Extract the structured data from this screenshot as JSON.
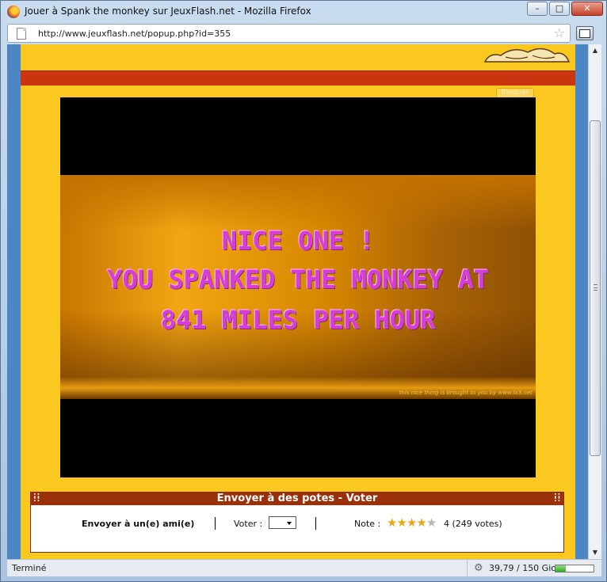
{
  "window": {
    "title": "Jouer à Spank the monkey sur JeuxFlash.net - Mozilla Firefox",
    "minimize": "–",
    "maximize": "□",
    "close": "✕"
  },
  "urlbar": {
    "url": "http://www.jeuxflash.net/popup.php?id=355",
    "star": "☆"
  },
  "page": {
    "bloquer": "Bloquer",
    "game": {
      "line1": "NICE ONE !",
      "line2": "YOU SPANKED THE MONKEY AT",
      "line3": "841 MILES PER HOUR",
      "credit": "this nice thing is brought to you by www.bi3.net"
    },
    "panel": {
      "title": "Envoyer à des potes - Voter",
      "send_friend": "Envoyer à un(e) ami(e)",
      "vote_label": "Voter :",
      "vote_value": "",
      "note_label": "Note :",
      "stars_filled": 4,
      "stars_total": 5,
      "rating_text": "4 (249 votes)"
    }
  },
  "status": {
    "text": "Terminé",
    "disk": "39,79 / 150 Gio",
    "disk_fraction": 0.27
  },
  "colors": {
    "page_bg": "#fbc81f",
    "band": "#c8350f",
    "text_pink": "#d93bd8",
    "viewport_blue": "#4c86c4"
  },
  "icons": [
    "firefox-icon",
    "page-icon",
    "bookmark-star-icon",
    "tabs-icon",
    "grip-icon",
    "star-icon",
    "gear-icon"
  ]
}
